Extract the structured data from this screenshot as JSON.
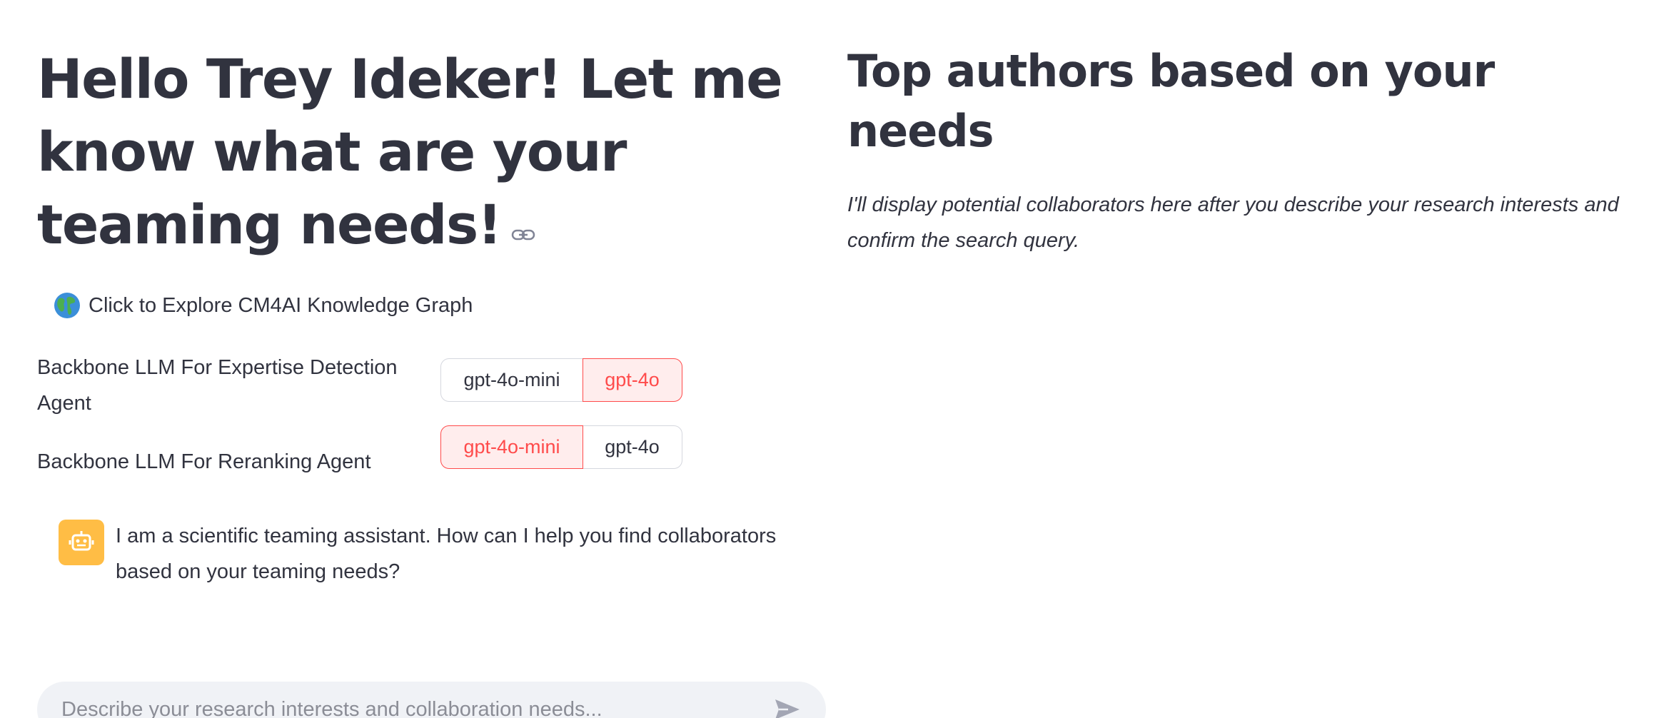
{
  "header": {
    "greeting": "Hello Trey Ideker! Let me know what are your teaming needs!"
  },
  "explore_link": {
    "label": "Click to Explore CM4AI Knowledge Graph",
    "icon": "globe-icon"
  },
  "settings": {
    "expertise_agent": {
      "label": "Backbone LLM For Expertise Detection Agent",
      "options": [
        "gpt-4o-mini",
        "gpt-4o"
      ],
      "selected": "gpt-4o"
    },
    "reranking_agent": {
      "label": "Backbone LLM For Reranking Agent",
      "options": [
        "gpt-4o-mini",
        "gpt-4o"
      ],
      "selected": "gpt-4o-mini"
    }
  },
  "chat": {
    "assistant_message": "I am a scientific teaming assistant. How can I help you find collaborators based on your teaming needs?",
    "input_placeholder": "Describe your research interests and collaboration needs...",
    "avatar_icon": "robot-icon",
    "send_icon": "send-icon"
  },
  "results": {
    "title": "Top authors based on your needs",
    "placeholder_text": "I'll display potential collaborators here after you describe your research interests and confirm the search query."
  },
  "colors": {
    "accent": "#ff4b4b",
    "accent_bg": "#ffeded",
    "avatar_bg": "#ffbd45",
    "text": "#31333f",
    "input_bg": "#f0f2f6"
  }
}
